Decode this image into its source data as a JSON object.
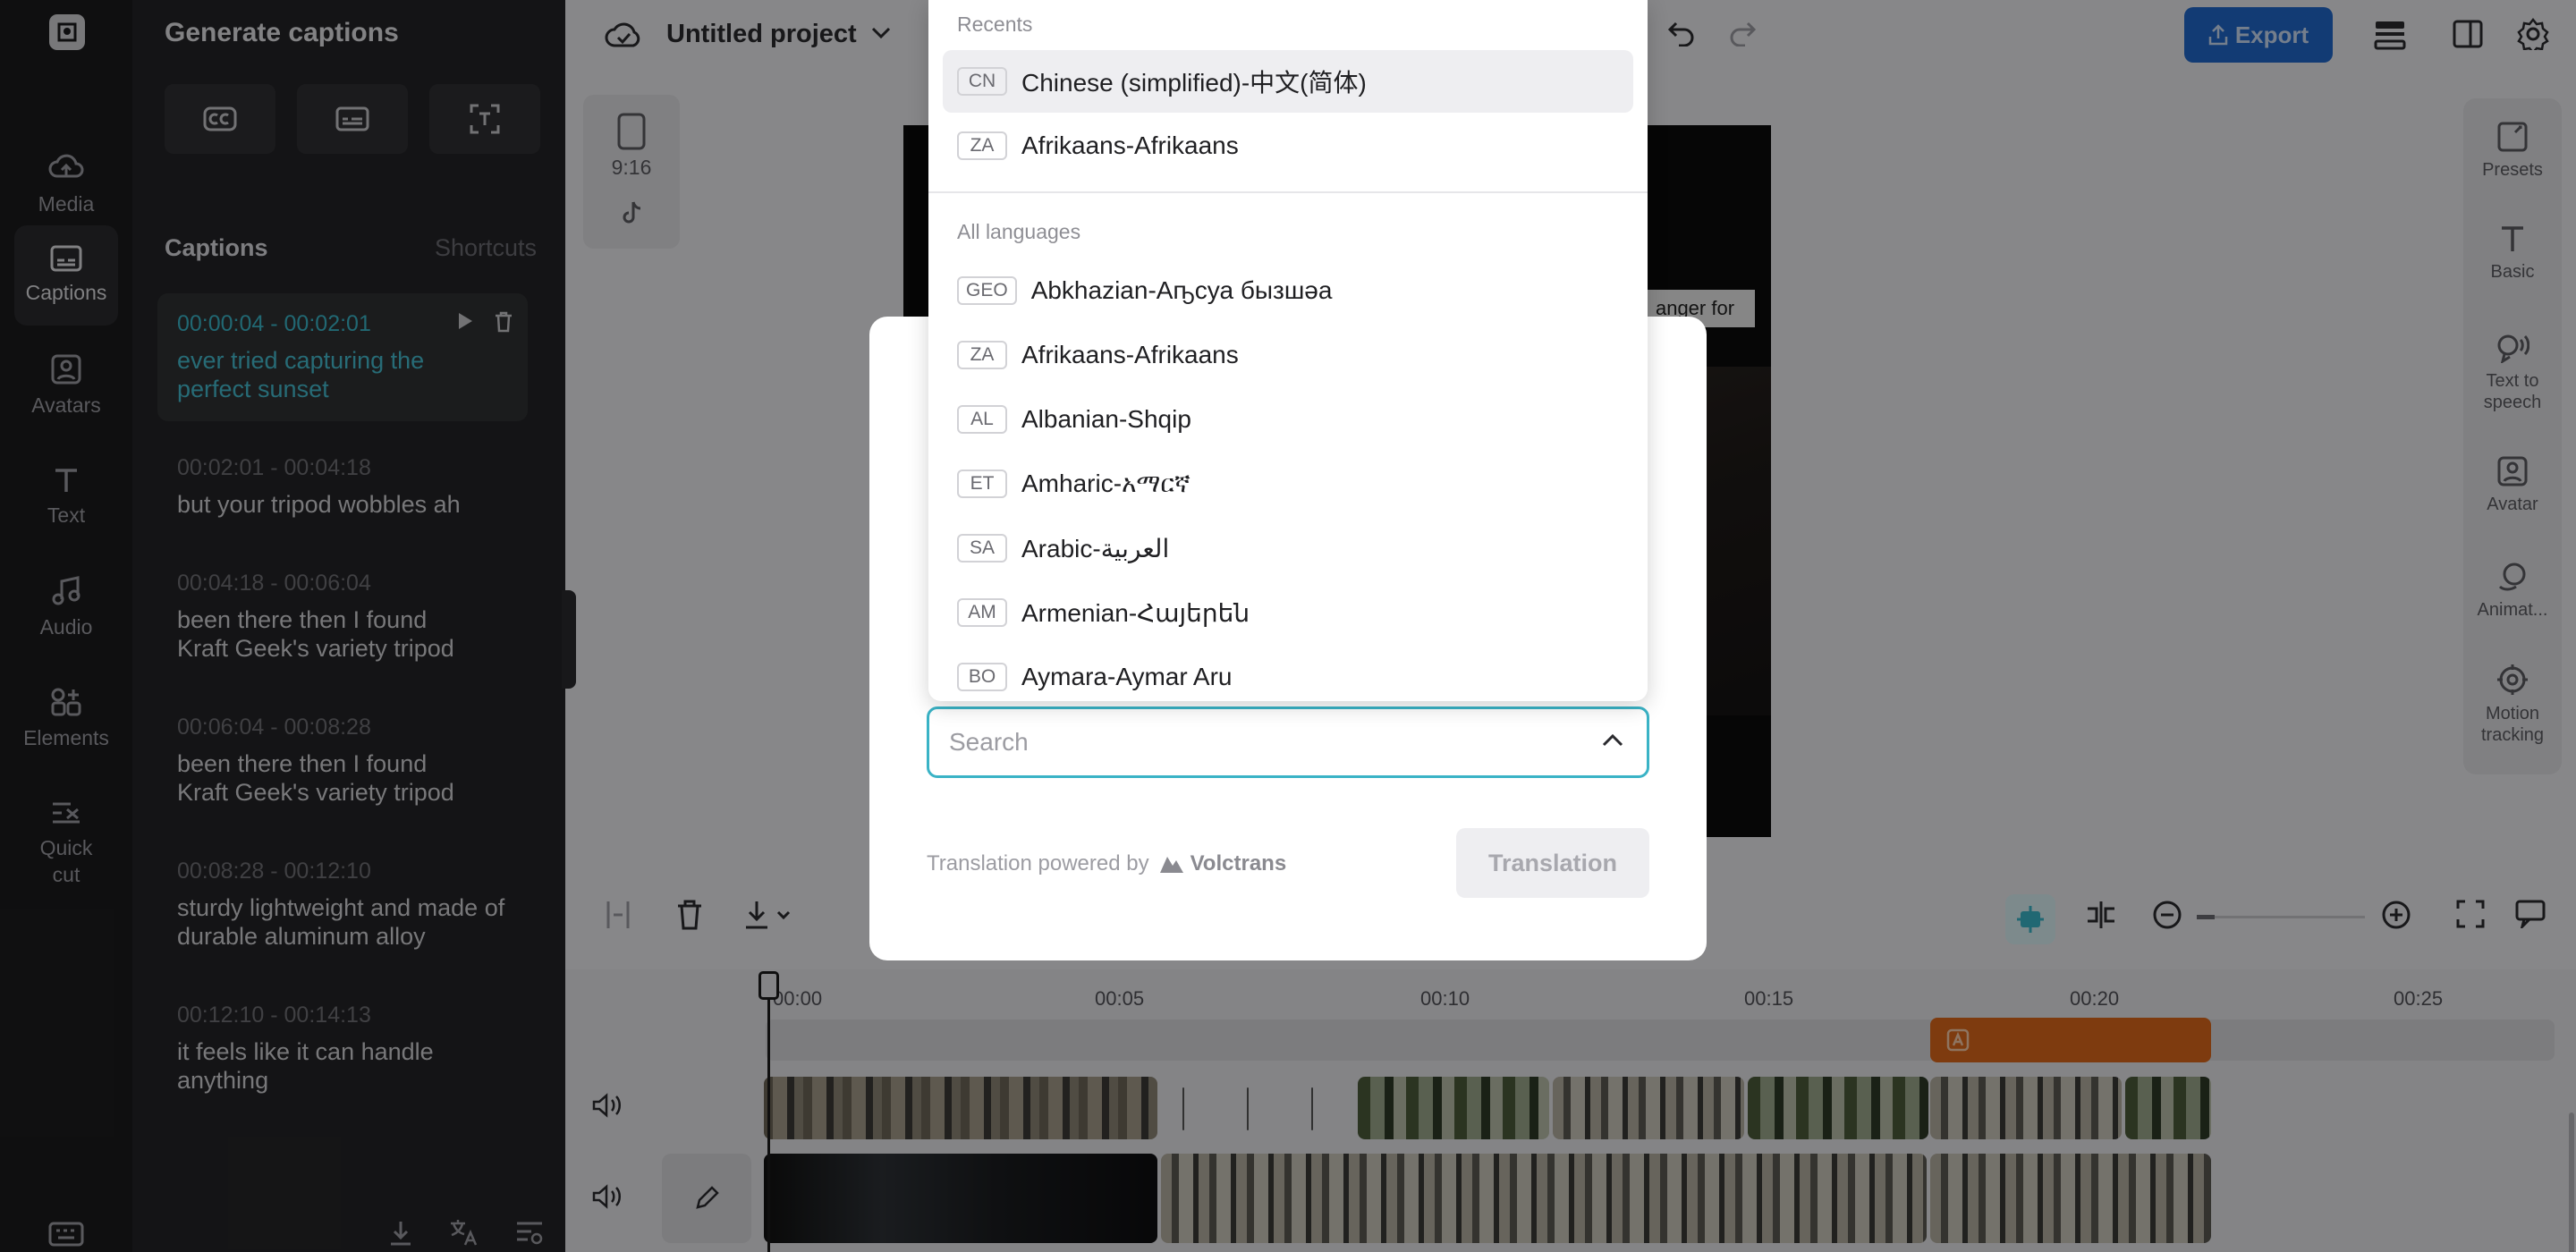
{
  "nav": {
    "items": [
      {
        "label": "Media",
        "icon": "cloud-upload-icon"
      },
      {
        "label": "Captions",
        "icon": "captions-icon"
      },
      {
        "label": "Avatars",
        "icon": "avatar-icon"
      },
      {
        "label": "Text",
        "icon": "text-icon"
      },
      {
        "label": "Audio",
        "icon": "music-note-icon"
      },
      {
        "label": "Elements",
        "icon": "elements-icon"
      },
      {
        "label": "Quick cut",
        "icon": "quick-cut-icon"
      }
    ]
  },
  "panel": {
    "title": "Generate captions",
    "tab_captions": "Captions",
    "tab_shortcuts": "Shortcuts",
    "captions": [
      {
        "time": "00:00:04 - 00:02:01",
        "text": "ever tried capturing the perfect sunset"
      },
      {
        "time": "00:02:01 - 00:04:18",
        "text": "but your tripod wobbles ah"
      },
      {
        "time": "00:04:18 - 00:06:04",
        "text": "been there then I found Kraft Geek's variety tripod"
      },
      {
        "time": "00:06:04 - 00:08:28",
        "text": "been there then I found Kraft Geek's variety tripod"
      },
      {
        "time": "00:08:28 - 00:12:10",
        "text": "sturdy lightweight and made of durable aluminum alloy"
      },
      {
        "time": "00:12:10 - 00:14:13",
        "text": "it feels like it can handle anything"
      }
    ]
  },
  "topbar": {
    "project_name": "Untitled project",
    "export_label": "Export"
  },
  "preview": {
    "ratio": "9:16",
    "caption_fragment": "anger for"
  },
  "right_tools": {
    "items": [
      {
        "label": "Presets",
        "icon": "presets-icon"
      },
      {
        "label": "Basic",
        "icon": "text-icon"
      },
      {
        "label": "Text to speech",
        "icon": "text-to-speech-icon"
      },
      {
        "label": "Avatar",
        "icon": "avatar-icon"
      },
      {
        "label": "Animat...",
        "icon": "animation-icon"
      },
      {
        "label": "Motion tracking",
        "icon": "motion-tracking-icon"
      }
    ]
  },
  "timeline": {
    "ticks": [
      "00:00",
      "00:05",
      "00:10",
      "00:15",
      "00:20",
      "00:25"
    ]
  },
  "dialog": {
    "search_placeholder": "Search",
    "powered_by": "Translation powered by",
    "provider": "Volctrans",
    "translate_label": "Translation"
  },
  "dropdown": {
    "recents_label": "Recents",
    "recents": [
      {
        "code": "CN",
        "label": "Chinese (simplified)-中文(简体)"
      },
      {
        "code": "ZA",
        "label": "Afrikaans-Afrikaans"
      }
    ],
    "all_label": "All languages",
    "languages": [
      {
        "code": "GEO",
        "label": "Abkhazian-Аҧсуа бызшәа"
      },
      {
        "code": "ZA",
        "label": "Afrikaans-Afrikaans"
      },
      {
        "code": "AL",
        "label": "Albanian-Shqip"
      },
      {
        "code": "ET",
        "label": "Amharic-አማርኛ"
      },
      {
        "code": "SA",
        "label": "Arabic-العربية"
      },
      {
        "code": "AM",
        "label": "Armenian-Հայերեն"
      },
      {
        "code": "BO",
        "label": "Aymara-Aymar Aru"
      }
    ]
  },
  "colors": {
    "accent": "#3ab3c6",
    "export": "#1f66c9",
    "clip_orange": "#d9661a"
  }
}
